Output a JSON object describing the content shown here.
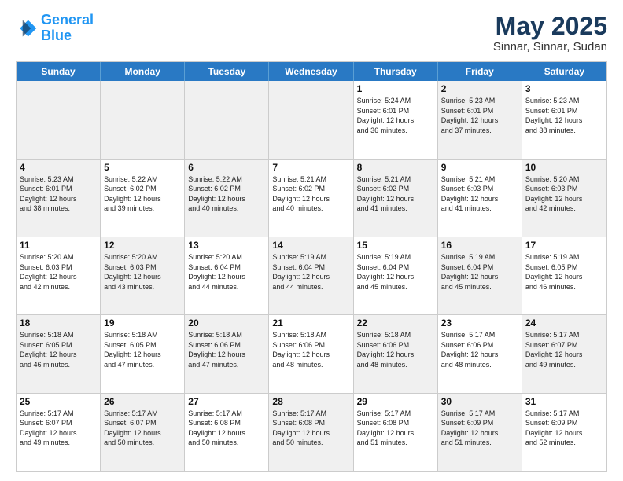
{
  "logo": {
    "line1": "General",
    "line2": "Blue"
  },
  "title": "May 2025",
  "subtitle": "Sinnar, Sinnar, Sudan",
  "header_days": [
    "Sunday",
    "Monday",
    "Tuesday",
    "Wednesday",
    "Thursday",
    "Friday",
    "Saturday"
  ],
  "weeks": [
    [
      {
        "day": "",
        "info": "",
        "shaded": true
      },
      {
        "day": "",
        "info": "",
        "shaded": true
      },
      {
        "day": "",
        "info": "",
        "shaded": true
      },
      {
        "day": "",
        "info": "",
        "shaded": true
      },
      {
        "day": "1",
        "info": "Sunrise: 5:24 AM\nSunset: 6:01 PM\nDaylight: 12 hours\nand 36 minutes.",
        "shaded": false
      },
      {
        "day": "2",
        "info": "Sunrise: 5:23 AM\nSunset: 6:01 PM\nDaylight: 12 hours\nand 37 minutes.",
        "shaded": true
      },
      {
        "day": "3",
        "info": "Sunrise: 5:23 AM\nSunset: 6:01 PM\nDaylight: 12 hours\nand 38 minutes.",
        "shaded": false
      }
    ],
    [
      {
        "day": "4",
        "info": "Sunrise: 5:23 AM\nSunset: 6:01 PM\nDaylight: 12 hours\nand 38 minutes.",
        "shaded": true
      },
      {
        "day": "5",
        "info": "Sunrise: 5:22 AM\nSunset: 6:02 PM\nDaylight: 12 hours\nand 39 minutes.",
        "shaded": false
      },
      {
        "day": "6",
        "info": "Sunrise: 5:22 AM\nSunset: 6:02 PM\nDaylight: 12 hours\nand 40 minutes.",
        "shaded": true
      },
      {
        "day": "7",
        "info": "Sunrise: 5:21 AM\nSunset: 6:02 PM\nDaylight: 12 hours\nand 40 minutes.",
        "shaded": false
      },
      {
        "day": "8",
        "info": "Sunrise: 5:21 AM\nSunset: 6:02 PM\nDaylight: 12 hours\nand 41 minutes.",
        "shaded": true
      },
      {
        "day": "9",
        "info": "Sunrise: 5:21 AM\nSunset: 6:03 PM\nDaylight: 12 hours\nand 41 minutes.",
        "shaded": false
      },
      {
        "day": "10",
        "info": "Sunrise: 5:20 AM\nSunset: 6:03 PM\nDaylight: 12 hours\nand 42 minutes.",
        "shaded": true
      }
    ],
    [
      {
        "day": "11",
        "info": "Sunrise: 5:20 AM\nSunset: 6:03 PM\nDaylight: 12 hours\nand 42 minutes.",
        "shaded": false
      },
      {
        "day": "12",
        "info": "Sunrise: 5:20 AM\nSunset: 6:03 PM\nDaylight: 12 hours\nand 43 minutes.",
        "shaded": true
      },
      {
        "day": "13",
        "info": "Sunrise: 5:20 AM\nSunset: 6:04 PM\nDaylight: 12 hours\nand 44 minutes.",
        "shaded": false
      },
      {
        "day": "14",
        "info": "Sunrise: 5:19 AM\nSunset: 6:04 PM\nDaylight: 12 hours\nand 44 minutes.",
        "shaded": true
      },
      {
        "day": "15",
        "info": "Sunrise: 5:19 AM\nSunset: 6:04 PM\nDaylight: 12 hours\nand 45 minutes.",
        "shaded": false
      },
      {
        "day": "16",
        "info": "Sunrise: 5:19 AM\nSunset: 6:04 PM\nDaylight: 12 hours\nand 45 minutes.",
        "shaded": true
      },
      {
        "day": "17",
        "info": "Sunrise: 5:19 AM\nSunset: 6:05 PM\nDaylight: 12 hours\nand 46 minutes.",
        "shaded": false
      }
    ],
    [
      {
        "day": "18",
        "info": "Sunrise: 5:18 AM\nSunset: 6:05 PM\nDaylight: 12 hours\nand 46 minutes.",
        "shaded": true
      },
      {
        "day": "19",
        "info": "Sunrise: 5:18 AM\nSunset: 6:05 PM\nDaylight: 12 hours\nand 47 minutes.",
        "shaded": false
      },
      {
        "day": "20",
        "info": "Sunrise: 5:18 AM\nSunset: 6:06 PM\nDaylight: 12 hours\nand 47 minutes.",
        "shaded": true
      },
      {
        "day": "21",
        "info": "Sunrise: 5:18 AM\nSunset: 6:06 PM\nDaylight: 12 hours\nand 48 minutes.",
        "shaded": false
      },
      {
        "day": "22",
        "info": "Sunrise: 5:18 AM\nSunset: 6:06 PM\nDaylight: 12 hours\nand 48 minutes.",
        "shaded": true
      },
      {
        "day": "23",
        "info": "Sunrise: 5:17 AM\nSunset: 6:06 PM\nDaylight: 12 hours\nand 48 minutes.",
        "shaded": false
      },
      {
        "day": "24",
        "info": "Sunrise: 5:17 AM\nSunset: 6:07 PM\nDaylight: 12 hours\nand 49 minutes.",
        "shaded": true
      }
    ],
    [
      {
        "day": "25",
        "info": "Sunrise: 5:17 AM\nSunset: 6:07 PM\nDaylight: 12 hours\nand 49 minutes.",
        "shaded": false
      },
      {
        "day": "26",
        "info": "Sunrise: 5:17 AM\nSunset: 6:07 PM\nDaylight: 12 hours\nand 50 minutes.",
        "shaded": true
      },
      {
        "day": "27",
        "info": "Sunrise: 5:17 AM\nSunset: 6:08 PM\nDaylight: 12 hours\nand 50 minutes.",
        "shaded": false
      },
      {
        "day": "28",
        "info": "Sunrise: 5:17 AM\nSunset: 6:08 PM\nDaylight: 12 hours\nand 50 minutes.",
        "shaded": true
      },
      {
        "day": "29",
        "info": "Sunrise: 5:17 AM\nSunset: 6:08 PM\nDaylight: 12 hours\nand 51 minutes.",
        "shaded": false
      },
      {
        "day": "30",
        "info": "Sunrise: 5:17 AM\nSunset: 6:09 PM\nDaylight: 12 hours\nand 51 minutes.",
        "shaded": true
      },
      {
        "day": "31",
        "info": "Sunrise: 5:17 AM\nSunset: 6:09 PM\nDaylight: 12 hours\nand 52 minutes.",
        "shaded": false
      }
    ]
  ]
}
